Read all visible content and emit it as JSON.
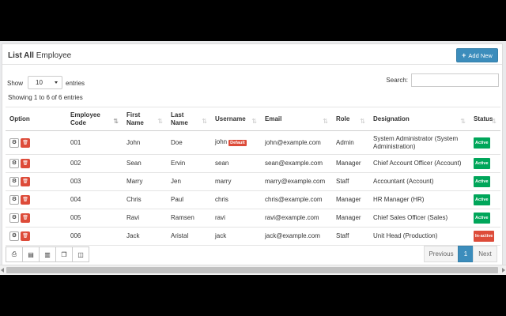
{
  "panel": {
    "title_bold": "List All",
    "title_rest": " Employee",
    "add_button": "Add New"
  },
  "controls": {
    "show_label": "Show",
    "entries_value": "10",
    "entries_label": "entries",
    "search_label": "Search:",
    "search_value": ""
  },
  "info": "Showing 1 to 6 of 6 entries",
  "columns": [
    {
      "l1": "Option",
      "l2": ""
    },
    {
      "l1": "Employee",
      "l2": "Code"
    },
    {
      "l1": "First",
      "l2": "Name"
    },
    {
      "l1": "Last",
      "l2": "Name"
    },
    {
      "l1": "Username",
      "l2": ""
    },
    {
      "l1": "Email",
      "l2": ""
    },
    {
      "l1": "Role",
      "l2": ""
    },
    {
      "l1": "Designation",
      "l2": ""
    },
    {
      "l1": "Status",
      "l2": ""
    }
  ],
  "rows": [
    {
      "code": "001",
      "first": "John",
      "last": "Doe",
      "username": "john",
      "badge": "Default",
      "email": "john@example.com",
      "role": "Admin",
      "designation": "System Administrator (System Administration)",
      "status": "Active"
    },
    {
      "code": "002",
      "first": "Sean",
      "last": "Ervin",
      "username": "sean",
      "badge": "",
      "email": "sean@example.com",
      "role": "Manager",
      "designation": "Chief Account Officer (Account)",
      "status": "Active"
    },
    {
      "code": "003",
      "first": "Marry",
      "last": "Jen",
      "username": "marry",
      "badge": "",
      "email": "marry@example.com",
      "role": "Staff",
      "designation": "Accountant (Account)",
      "status": "Active"
    },
    {
      "code": "004",
      "first": "Chris",
      "last": "Paul",
      "username": "chris",
      "badge": "",
      "email": "chris@example.com",
      "role": "Manager",
      "designation": "HR Manager (HR)",
      "status": "Active"
    },
    {
      "code": "005",
      "first": "Ravi",
      "last": "Ramsen",
      "username": "ravi",
      "badge": "",
      "email": "ravi@example.com",
      "role": "Manager",
      "designation": "Chief Sales Officer (Sales)",
      "status": "Active"
    },
    {
      "code": "006",
      "first": "Jack",
      "last": "Aristal",
      "username": "jack",
      "badge": "",
      "email": "jack@example.com",
      "role": "Staff",
      "designation": "Unit Head (Production)",
      "status": "In-active"
    }
  ],
  "toolbar_icons": [
    "print-icon",
    "excel-icon",
    "pdf-icon",
    "copy-icon",
    "columns-icon"
  ],
  "pagination": {
    "previous": "Previous",
    "current": "1",
    "next": "Next"
  },
  "colors": {
    "primary": "#3c8dbc",
    "danger": "#dd4b39",
    "success": "#00a65a"
  }
}
